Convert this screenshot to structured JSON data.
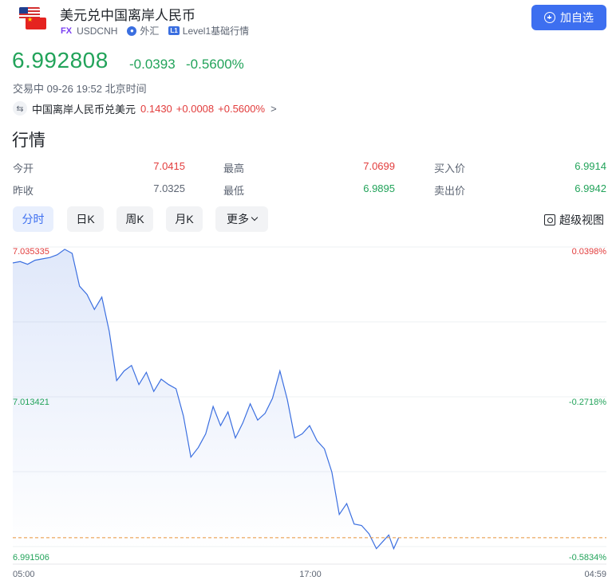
{
  "header": {
    "title": "美元兑中国离岸人民币",
    "fx_tag": "FX",
    "symbol": "USDCNH",
    "market": "外汇",
    "level_tag": "L1",
    "level_text": "Level1基础行情",
    "add_button": "加自选"
  },
  "price": {
    "last": "6.992808",
    "change": "-0.0393",
    "change_pct": "-0.5600%",
    "status": "交易中 09-26 19:52 北京时间"
  },
  "related": {
    "name": "中国离岸人民币兑美元",
    "price": "0.1430",
    "change": "+0.0008",
    "change_pct": "+0.5600%"
  },
  "quotes": {
    "section_title": "行情",
    "rows": [
      [
        {
          "label": "今开",
          "value": "7.0415",
          "color": "#e23c3c"
        },
        {
          "label": "最高",
          "value": "7.0699",
          "color": "#e23c3c"
        },
        {
          "label": "买入价",
          "value": "6.9914",
          "color": "#22a35a"
        }
      ],
      [
        {
          "label": "昨收",
          "value": "7.0325",
          "color": "#5d6573"
        },
        {
          "label": "最低",
          "value": "6.9895",
          "color": "#22a35a"
        },
        {
          "label": "卖出价",
          "value": "6.9942",
          "color": "#22a35a"
        }
      ]
    ]
  },
  "tabs": [
    "分时",
    "日K",
    "周K",
    "月K",
    "更多"
  ],
  "active_tab": "分时",
  "super_view": "超级视图",
  "chart_data": {
    "type": "line",
    "y_left_labels": [
      "7.035335",
      "7.013421",
      "6.991506"
    ],
    "y_right_labels": [
      "0.0398%",
      "-0.2718%",
      "-0.5834%"
    ],
    "x_labels": [
      "05:00",
      "17:00",
      "04:59"
    ],
    "ylim": [
      6.991506,
      7.035335
    ],
    "prev_close": 7.0325,
    "reference_line": 6.992808,
    "series_color": "#3b6fe0",
    "x_range": [
      0,
      24
    ],
    "x": [
      0,
      0.3,
      0.6,
      0.9,
      1.2,
      1.5,
      1.8,
      2.1,
      2.4,
      2.7,
      3.0,
      3.3,
      3.6,
      3.9,
      4.2,
      4.5,
      4.8,
      5.1,
      5.4,
      5.7,
      6.0,
      6.3,
      6.6,
      6.9,
      7.2,
      7.5,
      7.8,
      8.1,
      8.4,
      8.7,
      9.0,
      9.3,
      9.6,
      9.9,
      10.2,
      10.5,
      10.8,
      11.1,
      11.4,
      11.7,
      12.0,
      12.3,
      12.6,
      12.9,
      13.2,
      13.5,
      13.8,
      14.1,
      14.4,
      14.7,
      15.0,
      15.2,
      15.4,
      15.6
    ],
    "values": [
      7.033,
      7.0332,
      7.0328,
      7.0334,
      7.0336,
      7.0338,
      7.0342,
      7.035,
      7.0344,
      7.0296,
      7.0284,
      7.0262,
      7.028,
      7.023,
      7.0158,
      7.0172,
      7.018,
      7.0152,
      7.017,
      7.0142,
      7.016,
      7.0152,
      7.0146,
      7.0106,
      7.0046,
      7.006,
      7.008,
      7.012,
      7.0092,
      7.0112,
      7.0074,
      7.0096,
      7.0124,
      7.01,
      7.011,
      7.0132,
      7.0172,
      7.013,
      7.0074,
      7.008,
      7.0092,
      7.007,
      7.0058,
      7.0024,
      6.9962,
      6.9978,
      6.9948,
      6.9946,
      6.9934,
      6.9912,
      6.9924,
      6.9932,
      6.9912,
      6.9928
    ]
  }
}
